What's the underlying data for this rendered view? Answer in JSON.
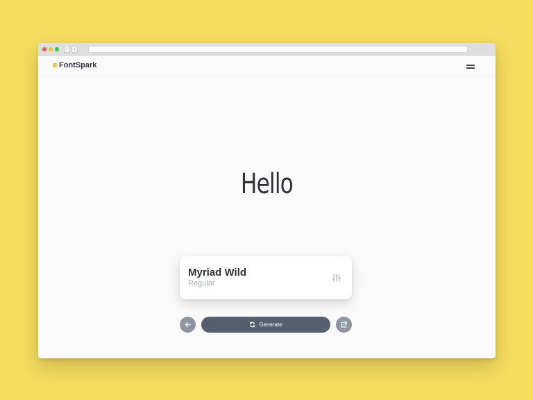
{
  "app": {
    "brand": "FontSpark",
    "accent_color": "#f0c94a",
    "background_color": "#f4dd5f"
  },
  "browser": {
    "back_icon": "chevron-left-icon",
    "forward_icon": "chevron-right-icon"
  },
  "header": {
    "menu_icon": "hamburger-menu-icon"
  },
  "preview": {
    "text": "Hello"
  },
  "font_card": {
    "name": "Myriad Wild",
    "style": "Regular",
    "settings_icon": "sliders-icon"
  },
  "actions": {
    "prev_icon": "arrow-left-icon",
    "generate_label": "Generate",
    "generate_icon": "refresh-icon",
    "open_icon": "external-link-icon",
    "button_color": "#555f6d"
  }
}
